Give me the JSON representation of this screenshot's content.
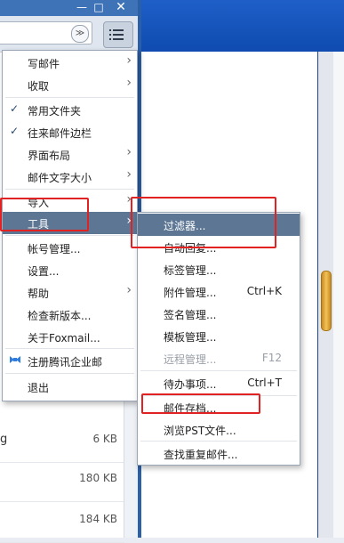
{
  "window_controls": {
    "minimize": "—",
    "maximize": "□",
    "close": "✕"
  },
  "search": {
    "dropdown_glyph": "≫"
  },
  "mail_list": [
    {
      "prefix": "g",
      "size": "6 KB"
    },
    {
      "prefix": "",
      "size": "180 KB"
    },
    {
      "prefix": "",
      "size": "184 KB"
    }
  ],
  "main_menu": {
    "write_mail": "写邮件",
    "receive": "收取",
    "common_folders": "常用文件夹",
    "contacts_sidebar": "往来邮件边栏",
    "layout": "界面布局",
    "mail_font_size": "邮件文字大小",
    "import": "导入",
    "tools": "工具",
    "account_mgmt": "帐号管理...",
    "settings": "设置...",
    "help": "帮助",
    "check_update": "检查新版本...",
    "about": "关于Foxmail...",
    "register_tencent": "注册腾讯企业邮",
    "exit": "退出",
    "check_glyph": "✓",
    "arrow_glyph": "›"
  },
  "tools_menu": {
    "filters": "过滤器...",
    "auto_reply": "自动回复...",
    "tag_mgmt": "标签管理...",
    "attachment_mgmt": "附件管理...",
    "attachment_shortcut": "Ctrl+K",
    "signature_mgmt": "签名管理...",
    "template_mgmt": "模板管理...",
    "remote_mgmt": "远程管理...",
    "remote_shortcut": "F12",
    "todo": "待办事项...",
    "todo_shortcut": "Ctrl+T",
    "mail_archive": "邮件存档...",
    "browse_pst": "浏览PST文件...",
    "find_duplicates": "查找重复邮件..."
  },
  "colors": {
    "highlight": "#5c7694",
    "annotation": "#e02222",
    "title_bar": "#3f73b7"
  }
}
